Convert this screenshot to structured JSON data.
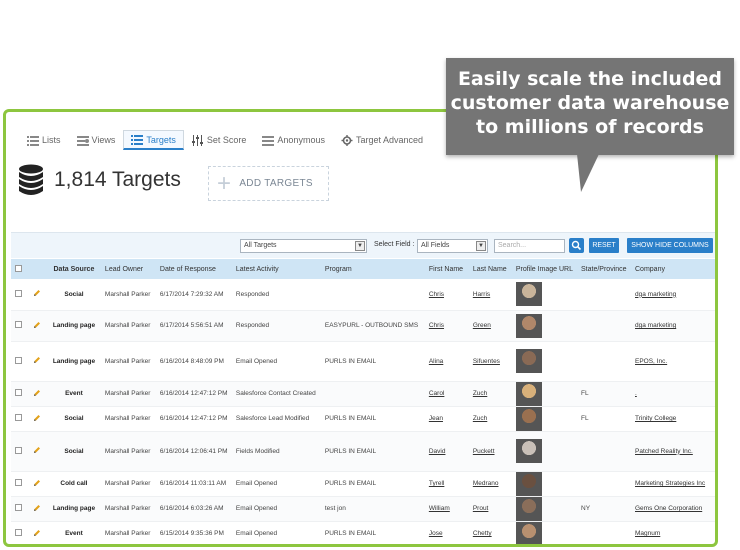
{
  "tabs": [
    {
      "label": "Lists",
      "icon": "list-icon"
    },
    {
      "label": "Views",
      "icon": "views-icon"
    },
    {
      "label": "Targets",
      "icon": "targets-icon"
    },
    {
      "label": "Set Score",
      "icon": "sliders-icon"
    },
    {
      "label": "Anonymous",
      "icon": "anonymous-icon"
    },
    {
      "label": "Target Advanced",
      "icon": "target-advanced-icon"
    }
  ],
  "header": {
    "title": "1,814 Targets",
    "add_label": "ADD TARGETS"
  },
  "toolbar": {
    "view_select": "All Targets",
    "field_label": "Select Field :",
    "field_select": "All Fields",
    "search_placeholder": "Search...",
    "reset_label": "RESET",
    "columns_label": "SHOW HIDE COLUMNS"
  },
  "columns": [
    "Data Source",
    "Lead Owner",
    "Date of Response",
    "Latest Activity",
    "Program",
    "First Name",
    "Last Name",
    "Profile Image URL",
    "State/Province",
    "Company"
  ],
  "rows": [
    {
      "source": "Social",
      "owner": "Marshall Parker",
      "date": "6/17/2014 7:29:32 AM",
      "activity": "Responded",
      "program": "",
      "first": "Chris",
      "last": "Harris",
      "state": "",
      "company": "dga marketing"
    },
    {
      "source": "Landing page",
      "owner": "Marshall Parker",
      "date": "6/17/2014 5:56:51 AM",
      "activity": "Responded",
      "program": "EASYPURL - OUTBOUND SMS",
      "first": "Chris",
      "last": "Green",
      "state": "",
      "company": "dga marketing"
    },
    {
      "source": "Landing page",
      "owner": "Marshall Parker",
      "date": "6/16/2014 8:48:09 PM",
      "activity": "Email Opened",
      "program": "PURLS IN EMAIL",
      "first": "Alina",
      "last": "Sifuentes",
      "state": "",
      "company": "EPOS, Inc."
    },
    {
      "source": "Event",
      "owner": "Marshall Parker",
      "date": "6/16/2014 12:47:12 PM",
      "activity": "Salesforce Contact Created",
      "program": "",
      "first": "Carol",
      "last": "Zuch",
      "state": "FL",
      "company": "."
    },
    {
      "source": "Social",
      "owner": "Marshall Parker",
      "date": "6/16/2014 12:47:12 PM",
      "activity": "Salesforce Lead Modified",
      "program": "PURLS IN EMAIL",
      "first": "Jean",
      "last": "Zuch",
      "state": "FL",
      "company": "Trinity College"
    },
    {
      "source": "Social",
      "owner": "Marshall Parker",
      "date": "6/16/2014 12:06:41 PM",
      "activity": "Fields Modified",
      "program": "PURLS IN EMAIL",
      "first": "David",
      "last": "Puckett",
      "state": "",
      "company": "Patched Reality Inc."
    },
    {
      "source": "Cold call",
      "owner": "Marshall Parker",
      "date": "6/16/2014 11:03:11 AM",
      "activity": "Email Opened",
      "program": "PURLS IN EMAIL",
      "first": "Tyrell",
      "last": "Medrano",
      "state": "",
      "company": "Marketing Strategies Inc"
    },
    {
      "source": "Landing page",
      "owner": "Marshall Parker",
      "date": "6/16/2014 6:03:26 AM",
      "activity": "Email Opened",
      "program": "test jon",
      "first": "William",
      "last": "Prout",
      "state": "NY",
      "company": "Gems One Corporation"
    },
    {
      "source": "Event",
      "owner": "Marshall Parker",
      "date": "6/15/2014 9:35:36 PM",
      "activity": "Email Opened",
      "program": "PURLS IN EMAIL",
      "first": "Jose",
      "last": "Chetty",
      "state": "",
      "company": "Magnum"
    }
  ],
  "callout": {
    "lines": [
      "Easily scale the included",
      "customer data warehouse",
      "to millions of records"
    ]
  },
  "colors": {
    "accent": "#2a7fc9",
    "frame": "#8dc63f",
    "callout": "#757575",
    "header_row": "#cfe5f5"
  }
}
